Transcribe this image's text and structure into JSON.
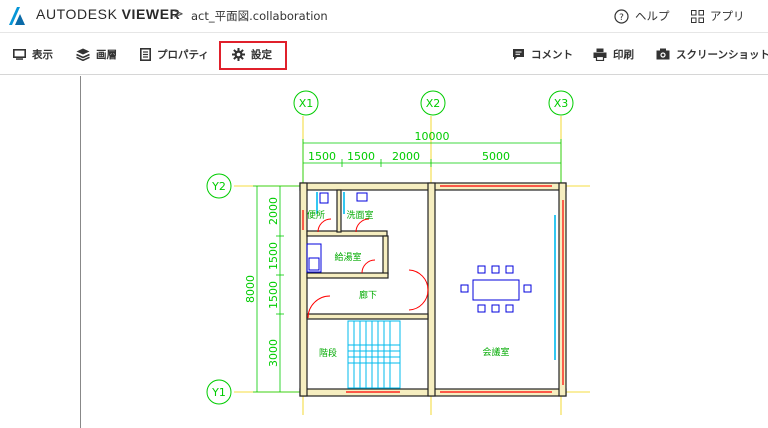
{
  "header": {
    "brand_a": "AUTODESK",
    "brand_b": "VIEWER",
    "breadcrumb_sep": ">",
    "filename": "act_平面図.collaboration",
    "help_label": "ヘルプ",
    "apps_label": "アプリ"
  },
  "toolbar": {
    "view_label": "表示",
    "sheets_label": "画層",
    "properties_label": "プロパティ",
    "settings_label": "設定",
    "comment_label": "コメント",
    "print_label": "印刷",
    "screenshot_label": "スクリーンショット"
  },
  "drawing": {
    "grid_x": [
      "X1",
      "X2",
      "X3"
    ],
    "grid_y": [
      "Y2",
      "Y1"
    ],
    "dim_total": "10000",
    "dim_segments": [
      "1500",
      "1500",
      "2000",
      "5000"
    ],
    "dim_vertical_total": "8000",
    "dim_vertical": [
      "2000",
      "1500",
      "1500",
      "3000"
    ],
    "rooms": {
      "toilet": "便所",
      "washroom": "洗面室",
      "kitchen": "給湯室",
      "corridor": "廊下",
      "stairs": "階段",
      "meeting": "会議室"
    }
  },
  "colors": {
    "highlight": "#e0202b",
    "cad_green": "#00cc00",
    "cad_red": "#ff0000",
    "cad_blue": "#0000dd",
    "cad_cyan": "#00bbee"
  }
}
